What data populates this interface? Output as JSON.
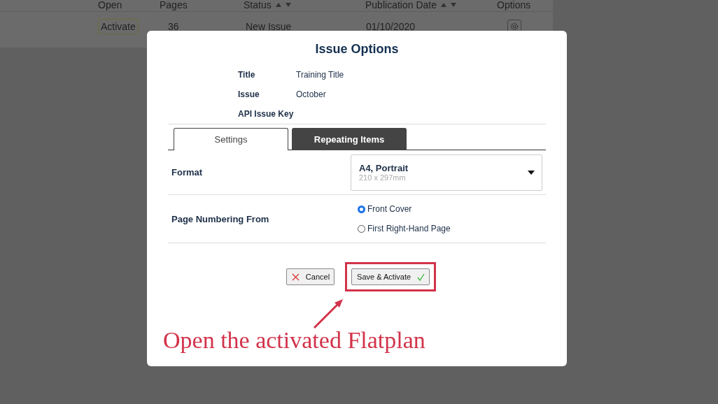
{
  "background_table": {
    "columns": [
      {
        "label": "Open",
        "sortable": false
      },
      {
        "label": "Pages",
        "sortable": false
      },
      {
        "label": "Status",
        "sortable": true
      },
      {
        "label": "Publication Date",
        "sortable": true
      },
      {
        "label": "Options",
        "sortable": false
      }
    ],
    "row": {
      "open": "Activate",
      "pages": "36",
      "status": "New Issue",
      "date": "01/10/2020"
    }
  },
  "dialog": {
    "title": "Issue Options",
    "info": [
      {
        "label": "Title",
        "value": "Training Title"
      },
      {
        "label": "Issue",
        "value": "October"
      },
      {
        "label": "API Issue Key"
      }
    ],
    "tabs": [
      {
        "label": "Settings",
        "selected": true
      },
      {
        "label": "Repeating Items",
        "selected": false
      }
    ],
    "format": {
      "label": "Format",
      "value": "A4, Portrait",
      "detail": "210 x 297mm"
    },
    "page_numbering": {
      "label": "Page Numbering From",
      "options": [
        {
          "label": "Front Cover",
          "selected": true
        },
        {
          "label": "First Right-Hand Page",
          "selected": false
        }
      ]
    },
    "buttons": [
      {
        "kind": "cancel",
        "label": "Cancel",
        "highlighted": false
      },
      {
        "kind": "confirm",
        "label": "Save & Activate",
        "highlighted": true
      }
    ]
  },
  "annotation": {
    "text": "Open the activated Flatplan"
  }
}
